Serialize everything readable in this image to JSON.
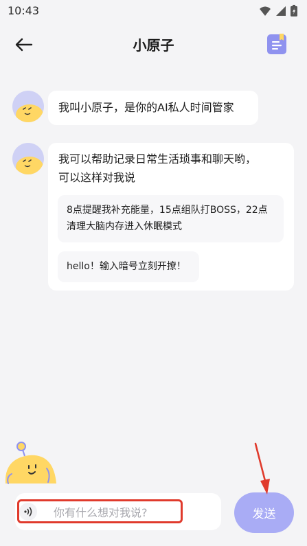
{
  "status_bar": {
    "time": "10:43",
    "icons": [
      "wifi-icon",
      "signal-icon",
      "battery-icon"
    ]
  },
  "header": {
    "title": "小原子",
    "back_icon": "back-arrow-icon",
    "action_icon": "notebook-icon"
  },
  "messages": [
    {
      "sender": "assistant",
      "text": "我叫小原子，是你的AI私人时间管家"
    },
    {
      "sender": "assistant",
      "text_lines": [
        "我可以帮助记录日常生活琐事和聊天哟，",
        "可以这样对我说"
      ],
      "suggestions": [
        {
          "lines": [
            "8点提醒我补充能量，15点组队打BOSS，22点",
            "清理大脑内存进入休眠模式"
          ]
        },
        {
          "lines": [
            "hello！输入暗号立刻开撩！"
          ]
        }
      ]
    }
  ],
  "composer": {
    "placeholder": "你有什么想对我说?",
    "value": "",
    "voice_icon": "voice-icon",
    "send_label": "发送"
  },
  "colors": {
    "background": "#f4f4f6",
    "accent": "#a9acf5",
    "notebook": "#8f92ef",
    "annotation": "#e03a2c",
    "avatar_bg": "#cfd1f5",
    "mascot": "#ffd764"
  }
}
